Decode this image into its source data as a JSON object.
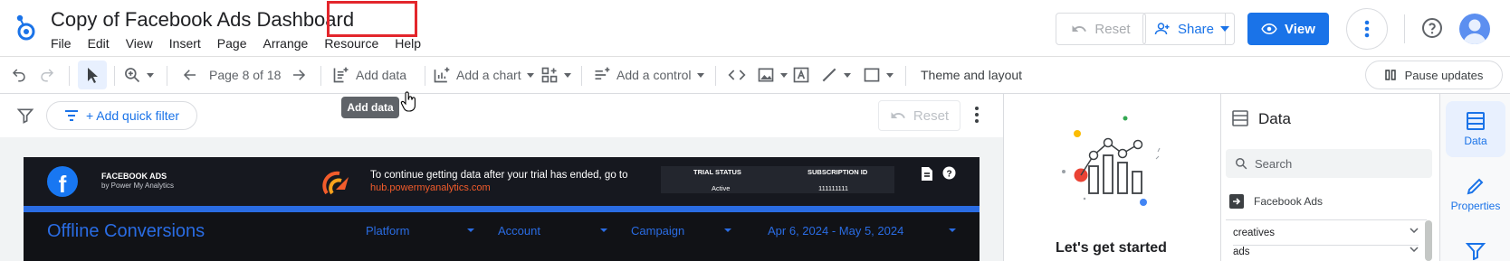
{
  "app": {
    "title": "Copy of Facebook Ads Dashboard",
    "menu": [
      "File",
      "Edit",
      "View",
      "Insert",
      "Page",
      "Arrange",
      "Resource",
      "Help"
    ],
    "reset_label": "Reset",
    "share_label": "Share",
    "view_label": "View"
  },
  "toolbar": {
    "page_indicator": "Page 8 of 18",
    "add_data_label": "Add data",
    "add_chart_label": "Add a chart",
    "add_control_label": "Add a control",
    "theme_label": "Theme and layout",
    "pause_label": "Pause updates",
    "tooltip": "Add data"
  },
  "filter_bar": {
    "quick_filter_label": "+ Add quick filter",
    "reset_label": "Reset"
  },
  "report": {
    "brand_title": "FACEBOOK ADS",
    "brand_subtitle": "by Power My Analytics",
    "trial_message": "To continue getting data after your trial has ended, go to",
    "trial_link": "hub.powermyanalytics.com",
    "trial_status_header": "TRIAL STATUS",
    "trial_status_value": "Active",
    "subscription_header": "SUBSCRIPTION ID",
    "subscription_value": "111111111",
    "page_title": "Offline Conversions",
    "controls": [
      "Platform",
      "Account",
      "Campaign",
      "Apr 6, 2024 - May 5, 2024"
    ],
    "colors": {
      "accent": "#2a6ce3",
      "background": "#111216",
      "link": "#f25c2b"
    }
  },
  "getting_started": {
    "text": "Let's get started"
  },
  "data_panel": {
    "title": "Data",
    "search_placeholder": "Search",
    "source": "Facebook Ads",
    "tables": [
      "creatives",
      "ads"
    ]
  },
  "side_rail": {
    "data_label": "Data",
    "properties_label": "Properties"
  }
}
